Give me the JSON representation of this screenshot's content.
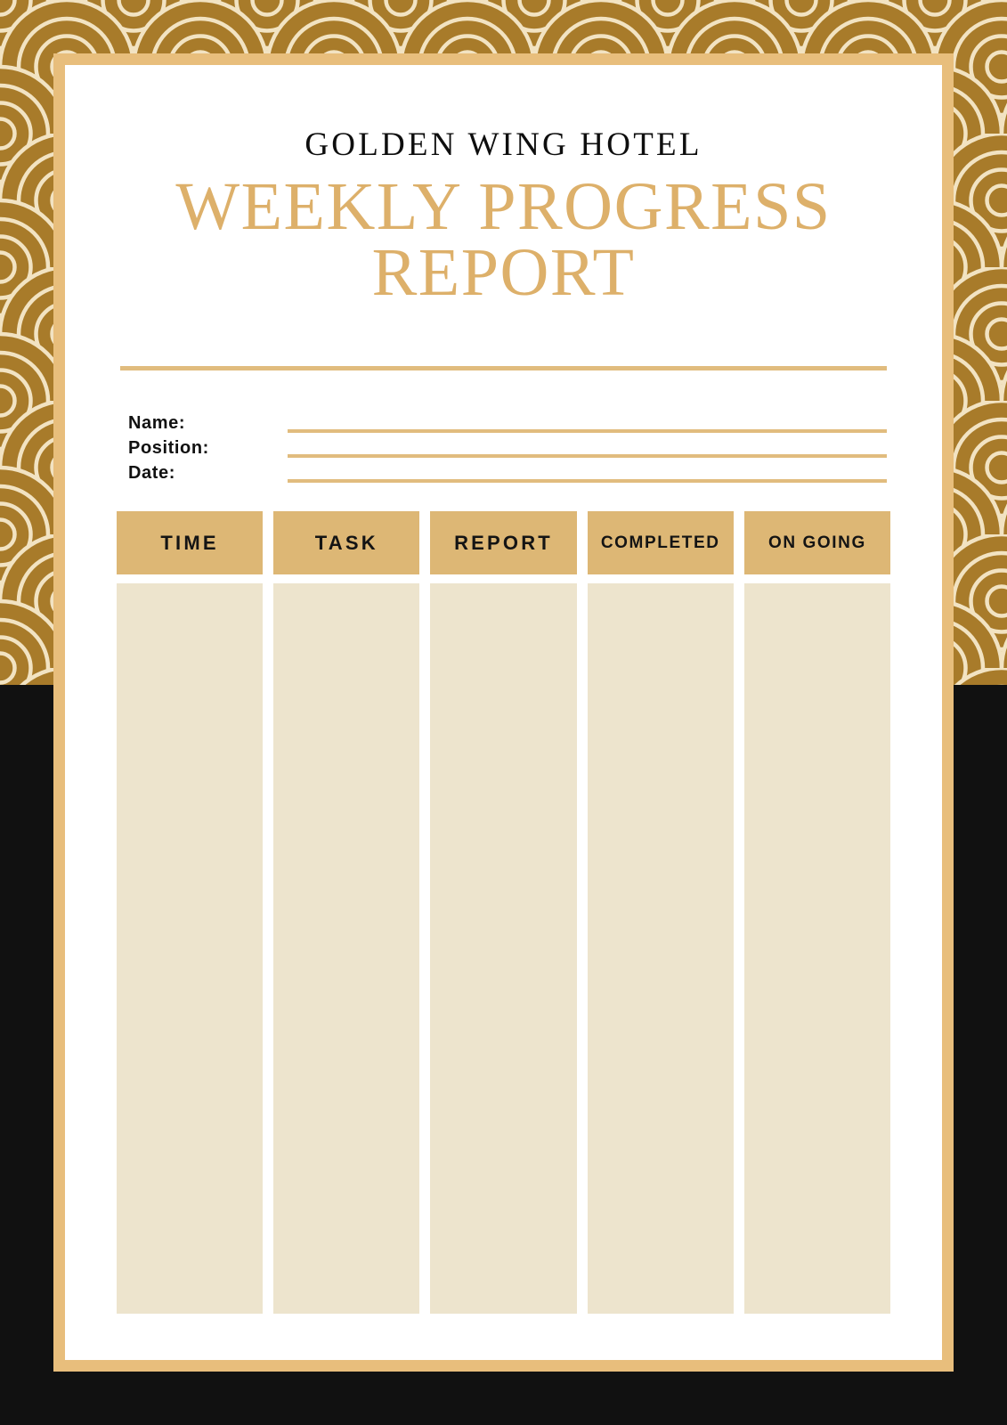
{
  "document": {
    "organization": "GOLDEN WING HOTEL",
    "title_line_1": "WEEKLY PROGRESS",
    "title_line_2": "REPORT"
  },
  "fields": [
    {
      "label": "Name:",
      "value": ""
    },
    {
      "label": "Position:",
      "value": ""
    },
    {
      "label": "Date:",
      "value": ""
    }
  ],
  "table": {
    "columns": [
      {
        "header": "TIME",
        "rows": []
      },
      {
        "header": "TASK",
        "rows": []
      },
      {
        "header": "REPORT",
        "rows": []
      },
      {
        "header": "COMPLETED",
        "rows": []
      },
      {
        "header": "ON GOING",
        "rows": []
      }
    ]
  },
  "colors": {
    "pattern_gold": "#A87B2A",
    "pattern_outline": "#F2E3C2",
    "frame_gold": "#E8BE7C",
    "title_gold": "#DDB06A",
    "rule_gold": "#E1BC7E",
    "header_fill": "#DDB775",
    "cell_fill": "#EDE4CD",
    "backdrop_black": "#111111",
    "text_dark": "#0E0E0E",
    "paper_white": "#FFFFFF"
  }
}
